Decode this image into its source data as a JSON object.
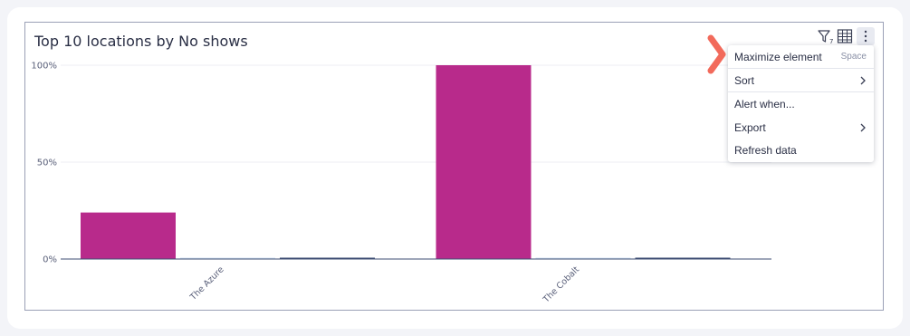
{
  "chart": {
    "title": "Top 10 locations by No shows"
  },
  "toolbar": {
    "filter_icon": "filter-icon",
    "filter_count": "7",
    "table_icon": "table-icon",
    "more_icon": "more-vertical-icon"
  },
  "menu": {
    "items": [
      {
        "label": "Maximize element",
        "shortcut": "Space"
      },
      {
        "label": "Sort",
        "submenu": true
      },
      {
        "label": "Alert when..."
      },
      {
        "label": "Export",
        "submenu": true
      },
      {
        "label": "Refresh data"
      }
    ]
  },
  "colors": {
    "bar_primary": "#b82a8b",
    "bar_light": "#d8e6f4",
    "bar_dark": "#3d4d73",
    "annotation_arrow": "#f26a5b"
  },
  "chart_data": {
    "type": "bar",
    "categories": [
      "The Azure",
      "The Cobalt"
    ],
    "series": [
      {
        "values": [
          24,
          100
        ],
        "color": "#b82a8b"
      },
      {
        "values": [
          0.3,
          0.3
        ],
        "color": "#d8e6f4"
      },
      {
        "values": [
          0.4,
          0.4
        ],
        "color": "#3d4d73"
      }
    ],
    "ylim": [
      0,
      100
    ],
    "yticks": [
      0,
      50,
      100
    ],
    "ytick_labels": [
      "0%",
      "50%",
      "100%"
    ],
    "grid": true,
    "legend": "none"
  }
}
